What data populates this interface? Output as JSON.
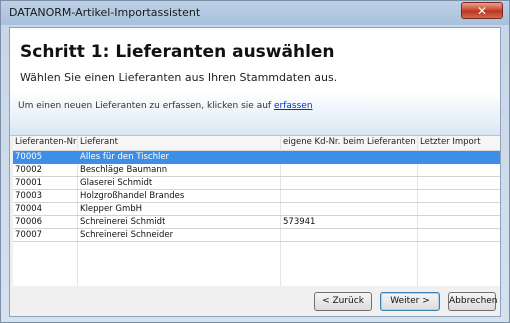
{
  "window": {
    "title": "DATANORM-Artikel-Importassistent",
    "close_label": "✕"
  },
  "header": {
    "step_title": "Schritt 1: Lieferanten auswählen",
    "step_subtitle": "Wählen Sie einen Lieferanten aus Ihren Stammdaten aus."
  },
  "hint": {
    "text": "Um einen neuen Lieferanten zu erfassen, klicken sie auf",
    "link": "erfassen"
  },
  "table": {
    "columns": [
      "Lieferanten-Nr",
      "Lieferant",
      "eigene Kd-Nr. beim Lieferanten",
      "Letzter Import"
    ],
    "rows": [
      {
        "nr": "70005",
        "name": "Alles für den Tischler",
        "kdnr": "",
        "last": "",
        "selected": true
      },
      {
        "nr": "70002",
        "name": "Beschläge Baumann",
        "kdnr": "",
        "last": "",
        "selected": false
      },
      {
        "nr": "70001",
        "name": "Glaserei Schmidt",
        "kdnr": "",
        "last": "",
        "selected": false
      },
      {
        "nr": "70003",
        "name": "Holzgroßhandel Brandes",
        "kdnr": "",
        "last": "",
        "selected": false
      },
      {
        "nr": "70004",
        "name": "Klepper GmbH",
        "kdnr": "",
        "last": "",
        "selected": false
      },
      {
        "nr": "70006",
        "name": "Schreinerei Schmidt",
        "kdnr": "573941",
        "last": "",
        "selected": false
      },
      {
        "nr": "70007",
        "name": "Schreinerei Schneider",
        "kdnr": "",
        "last": "",
        "selected": false
      }
    ]
  },
  "footer": {
    "back_label": "< Zurück",
    "next_label": "Weiter >",
    "cancel_label": "Abbrechen"
  }
}
